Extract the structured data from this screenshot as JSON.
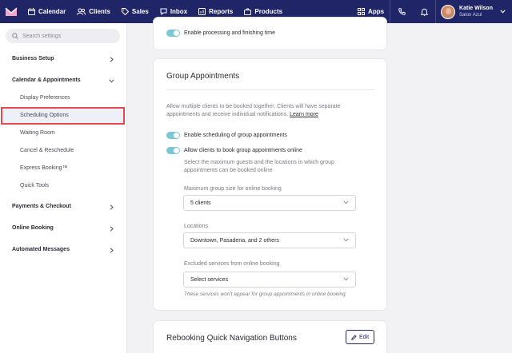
{
  "nav": {
    "items": [
      {
        "label": "Calendar",
        "icon": "calendar-icon"
      },
      {
        "label": "Clients",
        "icon": "clients-icon"
      },
      {
        "label": "Sales",
        "icon": "tag-icon"
      },
      {
        "label": "Inbox",
        "icon": "inbox-icon"
      },
      {
        "label": "Reports",
        "icon": "reports-icon"
      },
      {
        "label": "Products",
        "icon": "bag-icon"
      }
    ],
    "apps_label": "Apps",
    "user": {
      "name": "Katie Wilson",
      "location": "Salon Azul"
    },
    "colors": {
      "bar": "#1f2566",
      "accent": "#7cc7d3",
      "highlight": "#e5484d"
    }
  },
  "sidebar": {
    "search_placeholder": "Search settings",
    "sections": [
      {
        "label": "Business Setup"
      },
      {
        "label": "Calendar & Appointments"
      },
      {
        "label": "Payments & Checkout"
      },
      {
        "label": "Online Booking"
      },
      {
        "label": "Automated Messages"
      }
    ],
    "calendar_items": [
      {
        "label": "Display Preferences"
      },
      {
        "label": "Scheduling Options"
      },
      {
        "label": "Waiting Room"
      },
      {
        "label": "Cancel & Reschedule"
      },
      {
        "label": "Express Booking™"
      },
      {
        "label": "Quick Tools"
      }
    ],
    "selected": "Scheduling Options"
  },
  "main": {
    "top_card": {
      "toggle_label": "Enable processing and finishing time"
    },
    "group": {
      "title": "Group Appointments",
      "description_1": "Allow multiple clients to be booked together. Clients will have separate",
      "description_2": "appointments and receive individual notifications.",
      "learn_more": "Learn more",
      "toggle_1": "Enable scheduling of group appointments",
      "toggle_2": "Allow clients to book group appointments online",
      "sub_desc_1": "Select the maximum guests and the locations in which group",
      "sub_desc_2": "appointments can be booked online",
      "max_size_label": "Maximum group size for online booking",
      "max_size_value": "5 clients",
      "locations_label": "Locations",
      "locations_value": "Downtown, Pasadena, and 2 others",
      "excluded_label": "Excluded services from online booking",
      "excluded_placeholder": "Select services",
      "excluded_note": "These services won't appear for group appointments in online booking"
    },
    "rebooking": {
      "title": "Rebooking Quick Navigation Buttons",
      "edit_label": "Edit"
    }
  }
}
